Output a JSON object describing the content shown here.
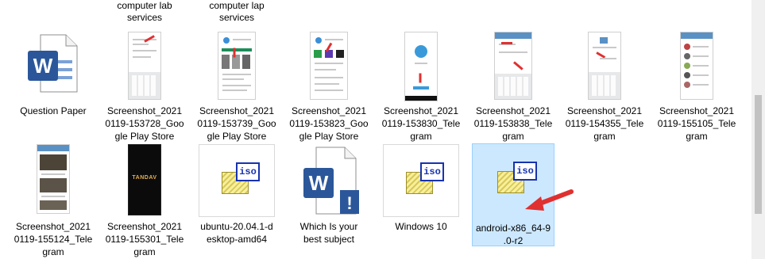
{
  "partial_top": [
    {
      "name": "partial-label-1",
      "text": "computer lab\nservices"
    },
    {
      "name": "partial-label-2",
      "text": "computer lap\nservices"
    }
  ],
  "files": [
    {
      "label": "Question Paper",
      "type": "word"
    },
    {
      "label": "Screenshot_2021\n0119-153728_Goo\ngle Play Store",
      "type": "phone"
    },
    {
      "label": "Screenshot_2021\n0119-153739_Goo\ngle Play Store",
      "type": "phone"
    },
    {
      "label": "Screenshot_2021\n0119-153823_Goo\ngle Play Store",
      "type": "phone"
    },
    {
      "label": "Screenshot_2021\n0119-153830_Tele\ngram",
      "type": "phone"
    },
    {
      "label": "Screenshot_2021\n0119-153838_Tele\ngram",
      "type": "phone"
    },
    {
      "label": "Screenshot_2021\n0119-154355_Tele\ngram",
      "type": "phone"
    },
    {
      "label": "Screenshot_2021\n0119-155105_Tele\ngram",
      "type": "phone"
    },
    {
      "label": "Screenshot_2021\n0119-155124_Tele\ngram",
      "type": "phone"
    },
    {
      "label": "Screenshot_2021\n0119-155301_Tele\ngram",
      "type": "phone-dark",
      "overlay_text": "TANDAV"
    },
    {
      "label": "ubuntu-20.04.1-d\nesktop-amd64",
      "type": "iso"
    },
    {
      "label": "Which Is your\nbest subject",
      "type": "word-alert"
    },
    {
      "label": "Windows 10",
      "type": "iso"
    },
    {
      "label": "android-x86_64-9\n.0-r2",
      "type": "iso",
      "selected": true
    }
  ],
  "icons": {
    "word_letter": "W",
    "iso_text": "iso",
    "alert_mark": "!"
  },
  "colors": {
    "selection_bg": "#cce8ff",
    "selection_border": "#99d1ff",
    "word_blue": "#2b579a",
    "annotation_red": "#e03030"
  }
}
